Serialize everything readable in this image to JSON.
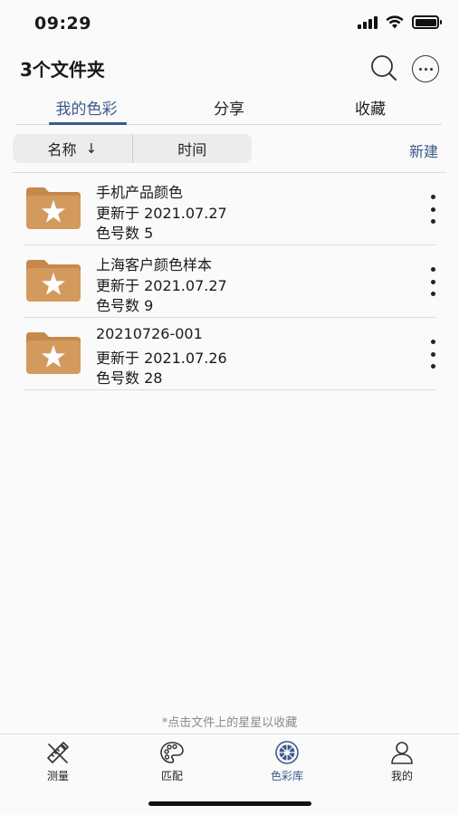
{
  "status": {
    "time": "09:29"
  },
  "header": {
    "title": "3个文件夹"
  },
  "tabs": [
    {
      "label": "我的色彩",
      "active": true
    },
    {
      "label": "分享",
      "active": false
    },
    {
      "label": "收藏",
      "active": false
    }
  ],
  "sort": {
    "name_label": "名称",
    "arrow": "↓",
    "time_label": "时间",
    "new_label": "新建"
  },
  "files": [
    {
      "name": "手机产品颜色",
      "updated": "更新于 2021.07.27",
      "count": "色号数 5"
    },
    {
      "name": "上海客户颜色样本",
      "updated": "更新于 2021.07.27",
      "count": "色号数 9"
    },
    {
      "name": "20210726-001",
      "updated": "更新于 2021.07.26",
      "count": "色号数 28"
    }
  ],
  "hint": "*点击文件上的星星以收藏",
  "tabbar": [
    {
      "label": "测量",
      "icon": "measure-icon",
      "active": false
    },
    {
      "label": "匹配",
      "icon": "palette-icon",
      "active": false
    },
    {
      "label": "色彩库",
      "icon": "color-library-icon",
      "active": true
    },
    {
      "label": "我的",
      "icon": "profile-icon",
      "active": false
    }
  ],
  "colors": {
    "accent": "#3b5a8c",
    "folder": "#d39a5e",
    "folder_dark": "#c5894d"
  }
}
